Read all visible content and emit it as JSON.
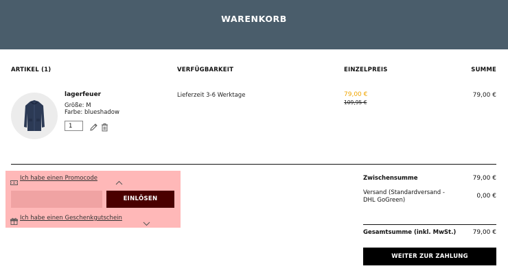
{
  "header": {
    "title": "WARENKORB"
  },
  "columns": {
    "article": "ARTIKEL (1)",
    "availability": "VERFÜGBARKEIT",
    "unit_price": "EINZELPREIS",
    "total": "SUMME"
  },
  "item": {
    "name": "lagerfeuer",
    "size": "Größe: M",
    "color": "Farbe: blueshadow",
    "quantity": "1",
    "availability": "Lieferzeit 3-6 Werktage",
    "price_new": "79,00 €",
    "price_old": "109,95 €",
    "sum": "79,00 €",
    "edit_icon": "pencil-icon",
    "delete_icon": "trash-icon"
  },
  "promo": {
    "promo_link": "Ich habe einen Promocode",
    "redeem_label": "EINLÖSEN",
    "voucher_link": "Ich habe einen Geschenkgutschein",
    "promo_icon": "ticket-icon",
    "voucher_icon": "gift-icon"
  },
  "totals": {
    "subtotal_label": "Zwischensumme",
    "subtotal_value": "79,00 €",
    "shipping_label_1": "Versand (Standardversand -",
    "shipping_label_2": "DHL GoGreen)",
    "shipping_value": "0,00 €",
    "grand_label": "Gesamtsumme (inkl. MwSt.)",
    "grand_value": "79,00 €",
    "checkout_label": "WEITER ZUR ZAHLUNG"
  },
  "colors": {
    "header_bg": "#4a5d6b",
    "sale_price": "#f0a500",
    "highlight": "#ffb8b8",
    "redeem_bg": "#4a0000"
  }
}
